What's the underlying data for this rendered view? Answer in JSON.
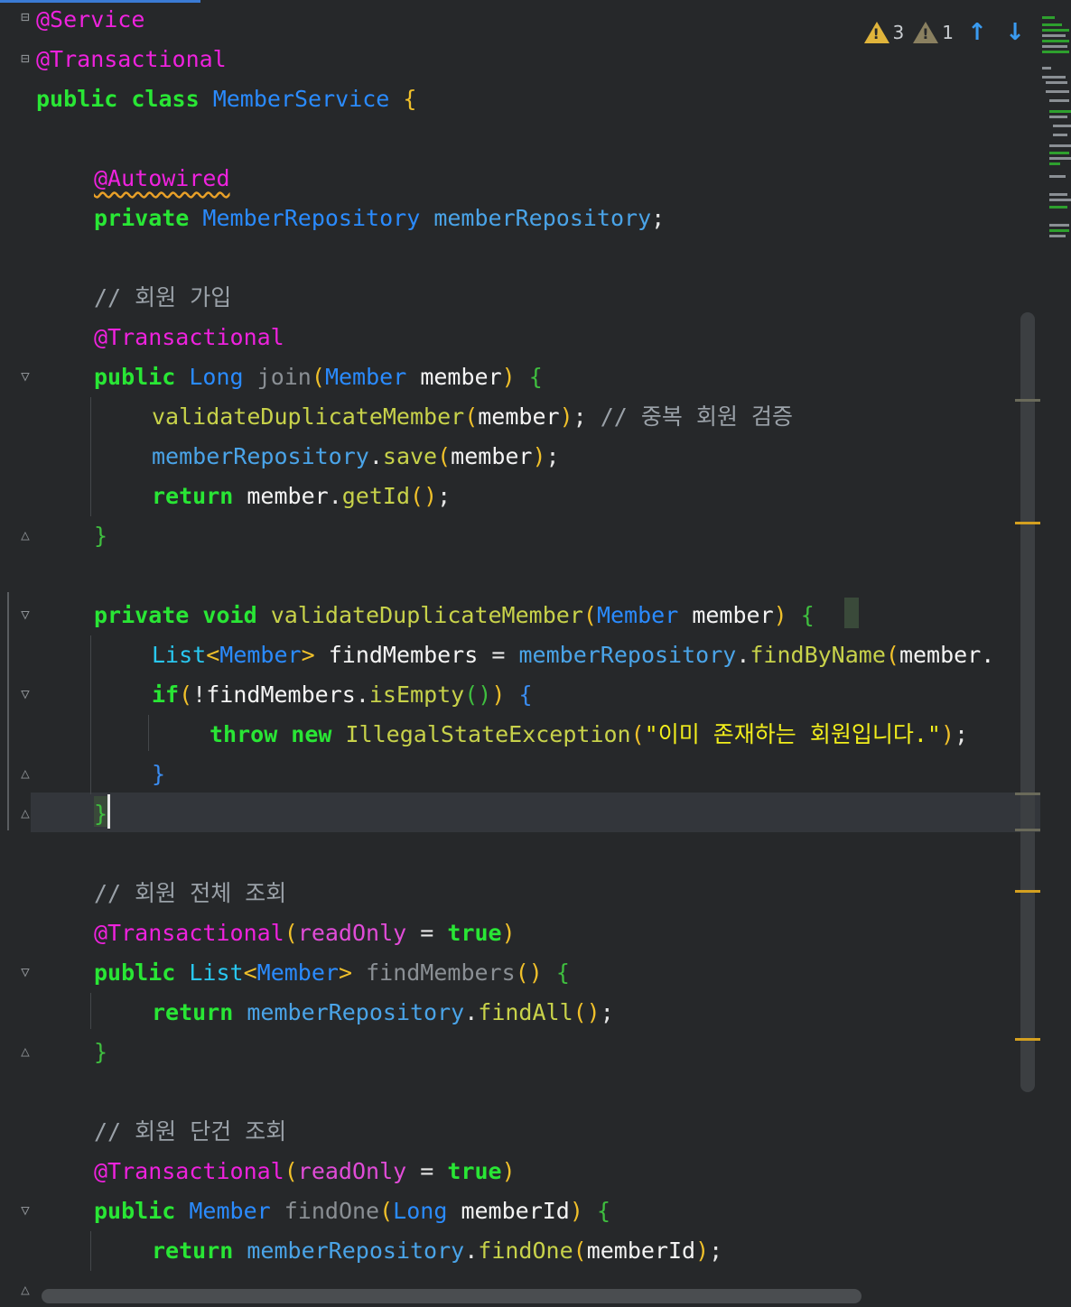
{
  "editor": {
    "inspections": {
      "warnings_count": "3",
      "weak_warnings_count": "1",
      "warning_icon": "warning-triangle-icon",
      "weak_warning_icon": "weak-warning-triangle-icon",
      "prev_icon": "arrow-up-icon",
      "next_icon": "arrow-down-icon"
    },
    "colors": {
      "background": "#26282a",
      "keyword": "#29e635",
      "annotation": "#ee22dd",
      "type": "#2a8bff",
      "method": "#c8d24a",
      "string": "#f2ee1c",
      "comment": "#9aa1a8",
      "warning": "#e0b43b"
    },
    "code": {
      "l1_ann": "@Service",
      "l2_ann": "@Transactional",
      "l3_kw": "public class",
      "l3_type": "MemberService",
      "l3_brace": "{",
      "l5_ann": "@Autowired",
      "l6_kw": "private",
      "l6_type": "MemberRepository",
      "l6_field": "memberRepository",
      "l6_semi": ";",
      "l8_comment": "// 회원 가입",
      "l9_ann": "@Transactional",
      "l10_kw": "public",
      "l10_type": "Long",
      "l10_method": "join",
      "l10_open": "(",
      "l10_ptype": "Member",
      "l10_param": "member",
      "l10_close": ")",
      "l10_brace": "{",
      "l11_method": "validateDuplicateMember",
      "l11_open": "(",
      "l11_arg": "member",
      "l11_close": ")",
      "l11_semi": ";",
      "l11_comment": "// 중복 회원 검증",
      "l12_field": "memberRepository",
      "l12_dot": ".",
      "l12_method": "save",
      "l12_open": "(",
      "l12_arg": "member",
      "l12_close": ")",
      "l12_semi": ";",
      "l13_kw": "return",
      "l13_var": "member",
      "l13_dot": ".",
      "l13_method": "getId",
      "l13_parens": "()",
      "l13_semi": ";",
      "l14_brace": "}",
      "l16_kw": "private void",
      "l16_method": "validateDuplicateMember",
      "l16_open": "(",
      "l16_ptype": "Member",
      "l16_param": "member",
      "l16_close": ")",
      "l16_brace": "{",
      "l17_type": "List",
      "l17_lt": "<",
      "l17_gtype": "Member",
      "l17_gt": ">",
      "l17_var": "findMembers",
      "l17_eq": "=",
      "l17_field": "memberRepository",
      "l17_dot": ".",
      "l17_method": "findByName",
      "l17_open": "(",
      "l17_arg": "member.",
      "l18_kw": "if",
      "l18_open": "(",
      "l18_not": "!",
      "l18_var": "findMembers",
      "l18_dot": ".",
      "l18_method": "isEmpty",
      "l18_parens": "()",
      "l18_close": ")",
      "l18_brace": "{",
      "l19_kw": "throw new",
      "l19_type": "IllegalStateException",
      "l19_open": "(",
      "l19_string": "\"이미 존재하는 회원입니다.\"",
      "l19_close": ")",
      "l19_semi": ";",
      "l20_brace": "}",
      "l21_brace": "}",
      "l23_comment": "// 회원 전체 조회",
      "l24_ann": "@Transactional",
      "l24_open": "(",
      "l24_attr": "readOnly",
      "l24_eq": "=",
      "l24_val": "true",
      "l24_close": ")",
      "l25_kw": "public",
      "l25_type": "List",
      "l25_lt": "<",
      "l25_gtype": "Member",
      "l25_gt": ">",
      "l25_method": "findMembers",
      "l25_parens": "()",
      "l25_brace": "{",
      "l26_kw": "return",
      "l26_field": "memberRepository",
      "l26_dot": ".",
      "l26_method": "findAll",
      "l26_parens": "()",
      "l26_semi": ";",
      "l27_brace": "}",
      "l29_comment": "// 회원 단건 조회",
      "l30_ann": "@Transactional",
      "l30_open": "(",
      "l30_attr": "readOnly",
      "l30_eq": "=",
      "l30_val": "true",
      "l30_close": ")",
      "l31_kw": "public",
      "l31_type": "Member",
      "l31_method": "findOne",
      "l31_open": "(",
      "l31_ptype": "Long",
      "l31_param": "memberId",
      "l31_close": ")",
      "l31_brace": "{",
      "l32_kw": "return",
      "l32_field": "memberRepository",
      "l32_dot": ".",
      "l32_method": "findOne",
      "l32_open": "(",
      "l32_arg": "memberId",
      "l32_close": ")",
      "l32_semi": ";"
    }
  }
}
